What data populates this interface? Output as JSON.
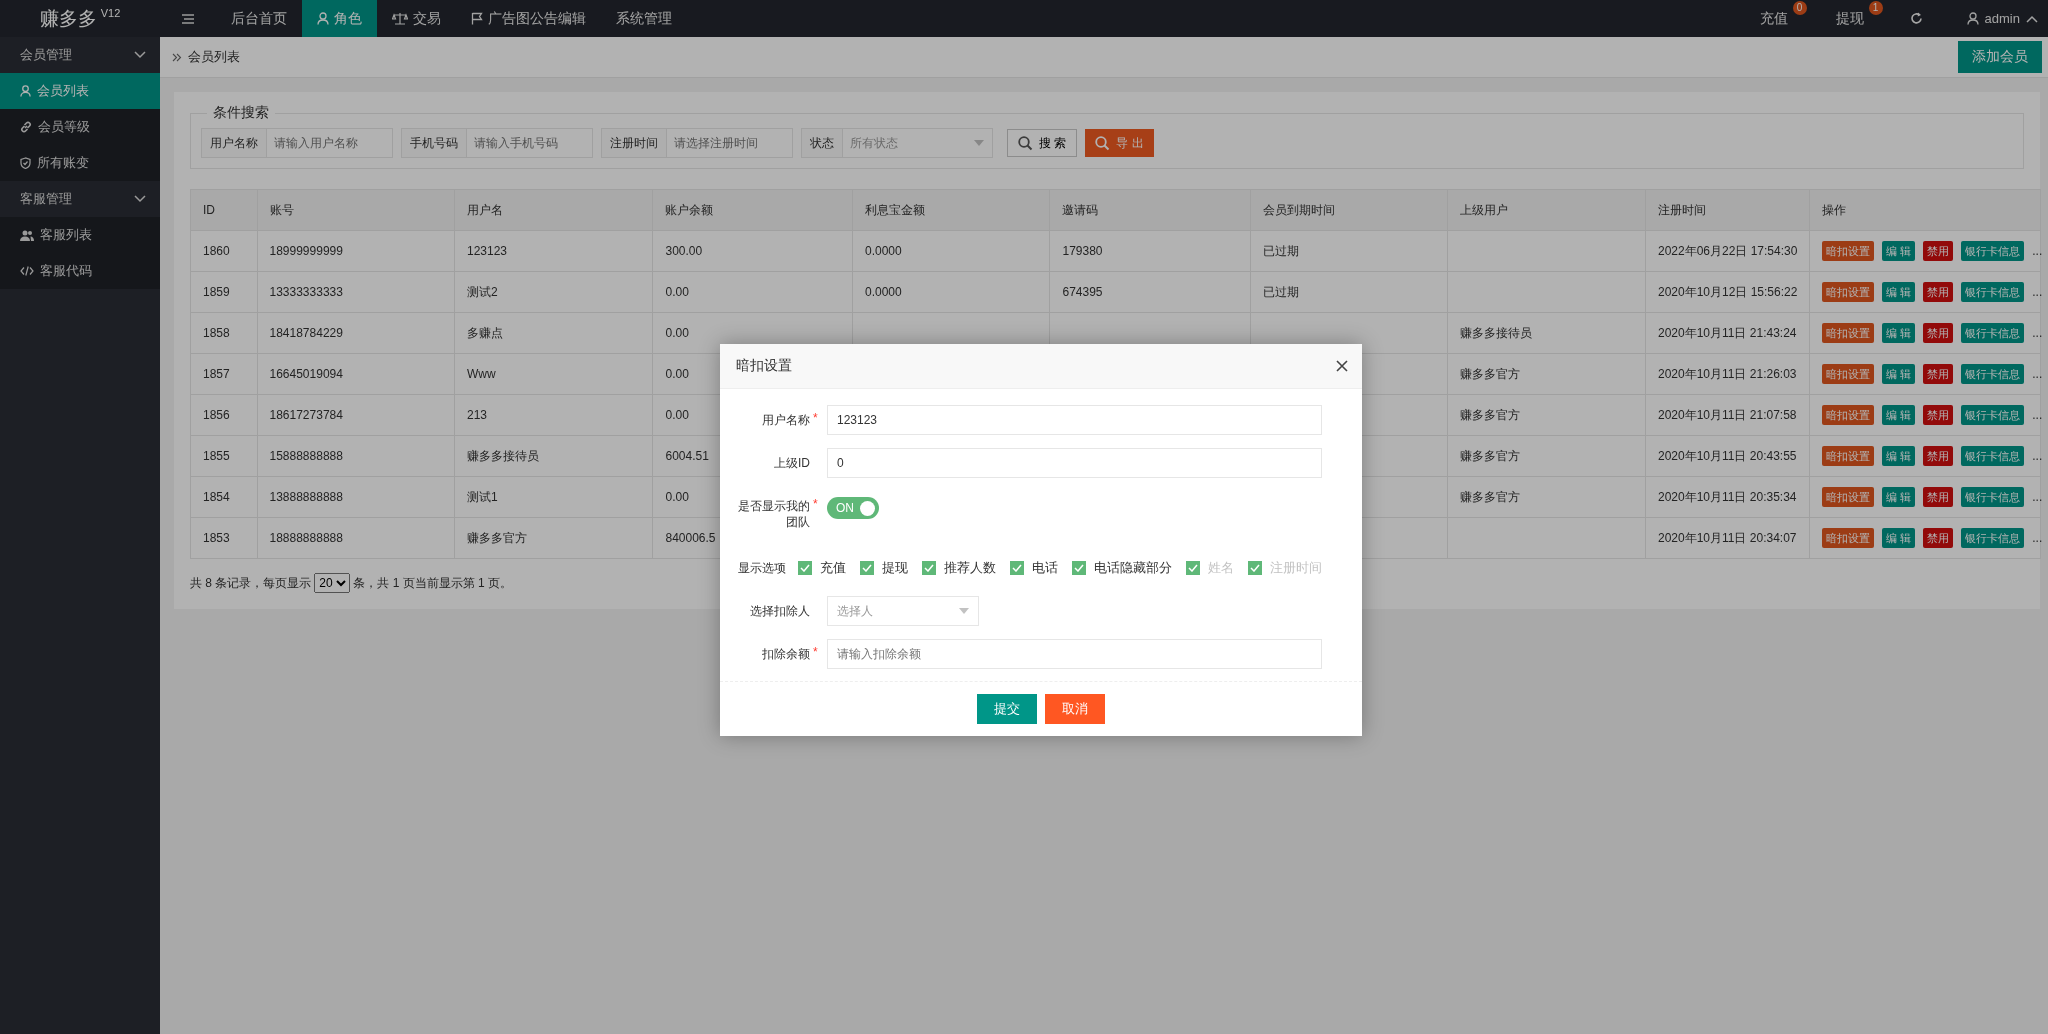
{
  "header": {
    "logo": "赚多多",
    "version": "V12",
    "nav": [
      {
        "label": "后台首页",
        "selected": false
      },
      {
        "label": "角色",
        "selected": true
      },
      {
        "label": "交易",
        "selected": false
      },
      {
        "label": "广告图公告编辑",
        "selected": false
      },
      {
        "label": "系统管理",
        "selected": false
      }
    ],
    "counters": [
      {
        "label": "充值",
        "badge": "0"
      },
      {
        "label": "提现",
        "badge": "1"
      }
    ],
    "user": "admin"
  },
  "sidebar": [
    {
      "label": "会员管理",
      "expanded": true,
      "children": [
        {
          "label": "会员列表",
          "selected": true
        },
        {
          "label": "会员等级",
          "selected": false
        },
        {
          "label": "所有账变",
          "selected": false
        }
      ]
    },
    {
      "label": "客服管理",
      "expanded": true,
      "children": [
        {
          "label": "客服列表",
          "selected": false
        },
        {
          "label": "客服代码",
          "selected": false
        }
      ]
    }
  ],
  "breadcrumb": "会员列表",
  "add_button": "添加会员",
  "search": {
    "legend": "条件搜索",
    "fields": [
      {
        "kind": "text",
        "label": "用户名称",
        "placeholder": "请输入用户名称"
      },
      {
        "kind": "text",
        "label": "手机号码",
        "placeholder": "请输入手机号码"
      },
      {
        "kind": "text",
        "label": "注册时间",
        "placeholder": "请选择注册时间"
      },
      {
        "kind": "select",
        "label": "状态",
        "placeholder": "所有状态"
      }
    ],
    "search_button": "搜 索",
    "export_button": "导 出"
  },
  "table": {
    "columns": [
      "ID",
      "账号",
      "用户名",
      "账户余额",
      "利息宝金额",
      "邀请码",
      "会员到期时间",
      "上级用户",
      "注册时间",
      "操作"
    ],
    "rows": [
      {
        "cells": [
          "1860",
          "18999999999",
          "123123",
          "300.00",
          "0.0000",
          "179380",
          "已过期",
          "",
          "2022年06月22日 17:54:30"
        ],
        "actions": [
          {
            "label": "暗扣设置",
            "kind": "deduct"
          },
          {
            "label": "编 辑",
            "kind": "edit"
          },
          {
            "label": "禁用",
            "kind": "ban"
          },
          {
            "label": "银行卡信息",
            "kind": "bank"
          }
        ],
        "more": "..."
      },
      {
        "cells": [
          "1859",
          "13333333333",
          "测试2",
          "0.00",
          "0.0000",
          "674395",
          "已过期",
          "",
          "2020年10月12日 15:56:22"
        ],
        "actions": [
          {
            "label": "暗扣设置",
            "kind": "deduct"
          },
          {
            "label": "编 辑",
            "kind": "edit"
          },
          {
            "label": "禁用",
            "kind": "ban"
          },
          {
            "label": "银行卡信息",
            "kind": "bank"
          }
        ],
        "more": "..."
      },
      {
        "cells": [
          "1858",
          "18418784229",
          "多赚点",
          "0.00",
          "",
          "",
          "",
          "赚多多接待员",
          "2020年10月11日 21:43:24"
        ],
        "actions": [
          {
            "label": "暗扣设置",
            "kind": "deduct"
          },
          {
            "label": "编 辑",
            "kind": "edit"
          },
          {
            "label": "禁用",
            "kind": "ban"
          },
          {
            "label": "银行卡信息",
            "kind": "bank"
          }
        ],
        "more": "..."
      },
      {
        "cells": [
          "1857",
          "16645019094",
          "Www",
          "0.00",
          "",
          "",
          "",
          "赚多多官方",
          "2020年10月11日 21:26:03"
        ],
        "actions": [
          {
            "label": "暗扣设置",
            "kind": "deduct"
          },
          {
            "label": "编 辑",
            "kind": "edit"
          },
          {
            "label": "禁用",
            "kind": "ban"
          },
          {
            "label": "银行卡信息",
            "kind": "bank"
          }
        ],
        "more": "..."
      },
      {
        "cells": [
          "1856",
          "18617273784",
          "213",
          "0.00",
          "",
          "",
          "",
          "赚多多官方",
          "2020年10月11日 21:07:58"
        ],
        "actions": [
          {
            "label": "暗扣设置",
            "kind": "deduct"
          },
          {
            "label": "编 辑",
            "kind": "edit"
          },
          {
            "label": "禁用",
            "kind": "ban"
          },
          {
            "label": "银行卡信息",
            "kind": "bank"
          }
        ],
        "more": "..."
      },
      {
        "cells": [
          "1855",
          "15888888888",
          "赚多多接待员",
          "6004.51",
          "",
          "",
          "",
          "赚多多官方",
          "2020年10月11日 20:43:55"
        ],
        "actions": [
          {
            "label": "暗扣设置",
            "kind": "deduct"
          },
          {
            "label": "编 辑",
            "kind": "edit"
          },
          {
            "label": "禁用",
            "kind": "ban"
          },
          {
            "label": "银行卡信息",
            "kind": "bank"
          }
        ],
        "more": "..."
      },
      {
        "cells": [
          "1854",
          "13888888888",
          "测试1",
          "0.00",
          "",
          "",
          "",
          "赚多多官方",
          "2020年10月11日 20:35:34"
        ],
        "actions": [
          {
            "label": "暗扣设置",
            "kind": "deduct"
          },
          {
            "label": "编 辑",
            "kind": "edit"
          },
          {
            "label": "禁用",
            "kind": "ban"
          },
          {
            "label": "银行卡信息",
            "kind": "bank"
          }
        ],
        "more": "..."
      },
      {
        "cells": [
          "1853",
          "18888888888",
          "赚多多官方",
          "840006.5",
          "",
          "",
          "",
          "",
          "2020年10月11日 20:34:07"
        ],
        "actions": [
          {
            "label": "暗扣设置",
            "kind": "deduct"
          },
          {
            "label": "编 辑",
            "kind": "edit"
          },
          {
            "label": "禁用",
            "kind": "ban"
          },
          {
            "label": "银行卡信息",
            "kind": "bank"
          }
        ],
        "more": "..."
      }
    ]
  },
  "pagination": {
    "before": "共 8 条记录，每页显示",
    "page_size": "20",
    "after": "条，共 1 页当前显示第 1 页。"
  },
  "modal": {
    "title": "暗扣设置",
    "fields": [
      {
        "kind": "text",
        "label": "用户名称",
        "required_mark": "*",
        "value": "123123"
      },
      {
        "kind": "text",
        "label": "上级ID",
        "value": "0"
      },
      {
        "kind": "switch",
        "label": "是否显示我的团队",
        "required_mark": "*",
        "on": true,
        "text": "ON"
      },
      {
        "kind": "checks",
        "label": "显示选项",
        "options": [
          {
            "label": "充值",
            "checked": true,
            "disabled": false
          },
          {
            "label": "提现",
            "checked": true,
            "disabled": false
          },
          {
            "label": "推荐人数",
            "checked": true,
            "disabled": false
          },
          {
            "label": "电话",
            "checked": true,
            "disabled": false
          },
          {
            "label": "电话隐藏部分",
            "checked": true,
            "disabled": false
          },
          {
            "label": "姓名",
            "checked": true,
            "disabled": true
          },
          {
            "label": "注册时间",
            "checked": true,
            "disabled": true
          }
        ]
      },
      {
        "kind": "select",
        "label": "选择扣除人",
        "placeholder": "选择人"
      },
      {
        "kind": "text",
        "label": "扣除余额",
        "required_mark": "*",
        "placeholder": "请输入扣除余额"
      }
    ],
    "buttons": [
      {
        "kind": "primary",
        "label": "提交"
      },
      {
        "kind": "danger",
        "label": "取消"
      }
    ]
  }
}
